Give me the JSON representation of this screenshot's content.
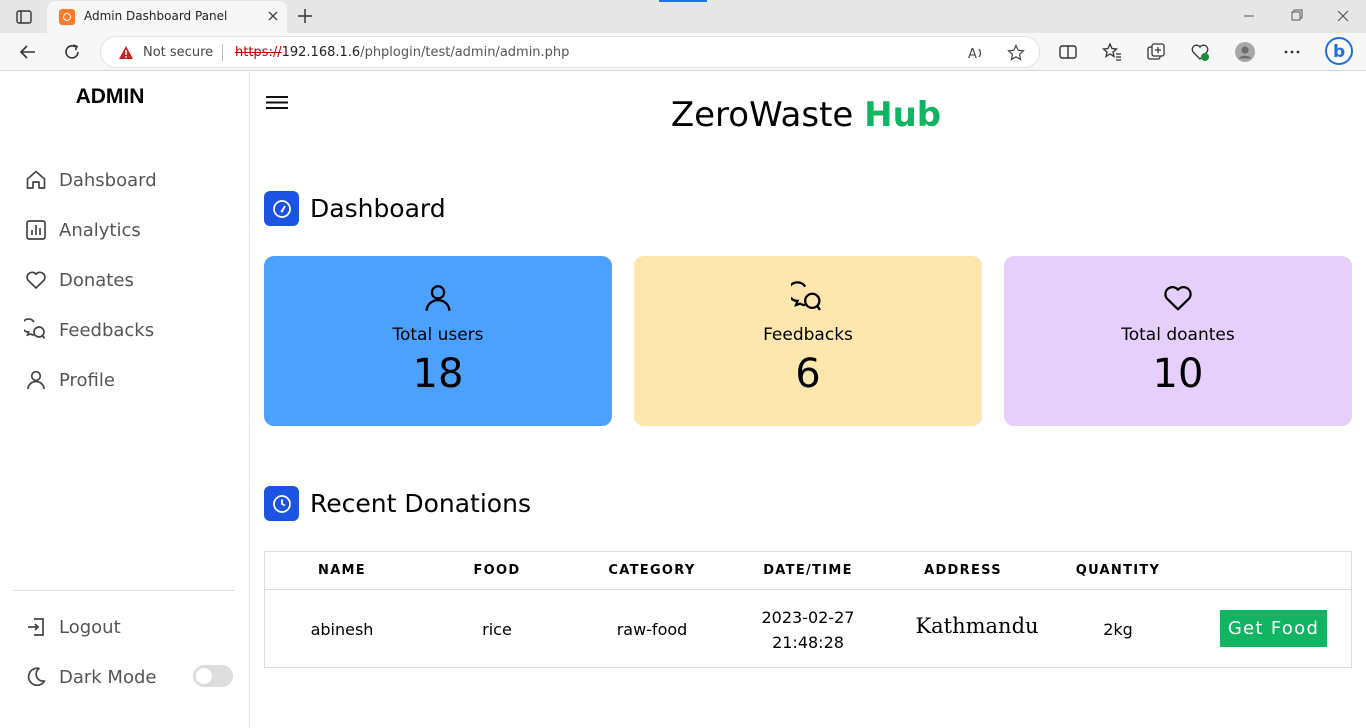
{
  "browser": {
    "tab_title": "Admin Dashboard Panel",
    "security_label": "Not secure",
    "url_scheme": "https://",
    "url_host": "192.168.1.6",
    "url_path": "/phplogin/test/admin/admin.php"
  },
  "sidebar": {
    "title": "ADMIN",
    "items": [
      {
        "label": "Dahsboard",
        "icon": "home-icon"
      },
      {
        "label": "Analytics",
        "icon": "analytics-icon"
      },
      {
        "label": "Donates",
        "icon": "heart-icon"
      },
      {
        "label": "Feedbacks",
        "icon": "chat-icon"
      },
      {
        "label": "Profile",
        "icon": "user-icon"
      }
    ],
    "logout_label": "Logout",
    "dark_mode_label": "Dark Mode",
    "dark_mode_on": false
  },
  "header": {
    "brand_main": "ZeroWaste",
    "brand_accent": "Hub",
    "accent_color": "#11b561"
  },
  "dashboard": {
    "title": "Dashboard",
    "cards": [
      {
        "label": "Total users",
        "value": "18",
        "color": "#4ca1ff",
        "icon": "user-icon"
      },
      {
        "label": "Feedbacks",
        "value": "6",
        "color": "#fde7ae",
        "icon": "chat-icon"
      },
      {
        "label": "Total doantes",
        "value": "10",
        "color": "#e6d0fb",
        "icon": "heart-icon"
      }
    ]
  },
  "recent": {
    "title": "Recent Donations",
    "columns": [
      "NAME",
      "FOOD",
      "CATEGORY",
      "DATE/TIME",
      "ADDRESS",
      "QUANTITY"
    ],
    "rows": [
      {
        "name": "abinesh",
        "food": "rice",
        "category": "raw-food",
        "date": "2023-02-27",
        "time": "21:48:28",
        "address": "Kathmandu",
        "quantity": "2kg",
        "action": "Get Food"
      }
    ]
  }
}
